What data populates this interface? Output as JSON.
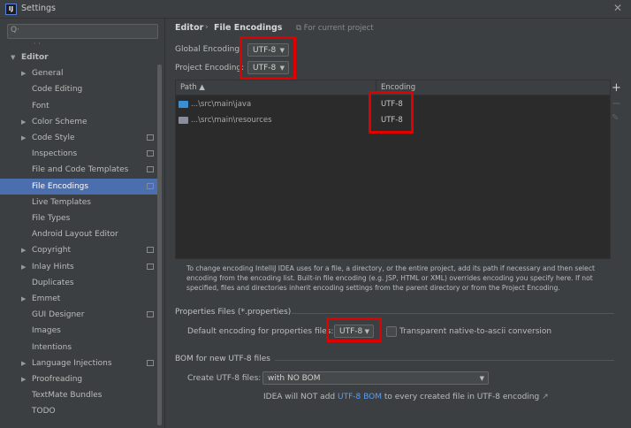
{
  "window": {
    "title": "Settings",
    "app_icon_text": "IJ"
  },
  "sidebar": {
    "search_placeholder": "Q·",
    "items": [
      {
        "label": "Editor",
        "indent": 0,
        "arrow": "expanded",
        "bold": true
      },
      {
        "label": "General",
        "indent": 1,
        "arrow": "collapsed"
      },
      {
        "label": "Code Editing",
        "indent": 1,
        "arrow": "none"
      },
      {
        "label": "Font",
        "indent": 1,
        "arrow": "none"
      },
      {
        "label": "Color Scheme",
        "indent": 1,
        "arrow": "collapsed"
      },
      {
        "label": "Code Style",
        "indent": 1,
        "arrow": "collapsed",
        "project": true
      },
      {
        "label": "Inspections",
        "indent": 1,
        "arrow": "none",
        "project": true
      },
      {
        "label": "File and Code Templates",
        "indent": 1,
        "arrow": "none",
        "project": true
      },
      {
        "label": "File Encodings",
        "indent": 1,
        "arrow": "none",
        "project": true,
        "selected": true
      },
      {
        "label": "Live Templates",
        "indent": 1,
        "arrow": "none"
      },
      {
        "label": "File Types",
        "indent": 1,
        "arrow": "none"
      },
      {
        "label": "Android Layout Editor",
        "indent": 1,
        "arrow": "none"
      },
      {
        "label": "Copyright",
        "indent": 1,
        "arrow": "collapsed",
        "project": true
      },
      {
        "label": "Inlay Hints",
        "indent": 1,
        "arrow": "collapsed",
        "project": true
      },
      {
        "label": "Duplicates",
        "indent": 1,
        "arrow": "none"
      },
      {
        "label": "Emmet",
        "indent": 1,
        "arrow": "collapsed"
      },
      {
        "label": "GUI Designer",
        "indent": 1,
        "arrow": "none",
        "project": true
      },
      {
        "label": "Images",
        "indent": 1,
        "arrow": "none"
      },
      {
        "label": "Intentions",
        "indent": 1,
        "arrow": "none"
      },
      {
        "label": "Language Injections",
        "indent": 1,
        "arrow": "collapsed",
        "project": true
      },
      {
        "label": "Proofreading",
        "indent": 1,
        "arrow": "collapsed"
      },
      {
        "label": "TextMate Bundles",
        "indent": 1,
        "arrow": "none"
      },
      {
        "label": "TODO",
        "indent": 1,
        "arrow": "none"
      }
    ]
  },
  "breadcrumb": {
    "parent": "Editor",
    "separator": "›",
    "current": "File Encodings",
    "note": "For current project"
  },
  "global_encoding": {
    "label": "Global Encoding:",
    "value": "UTF-8"
  },
  "project_encoding": {
    "label": "Project Encoding:",
    "value": "UTF-8"
  },
  "table": {
    "headers": {
      "path": "Path ▲",
      "encoding": "Encoding"
    },
    "rows": [
      {
        "path": "...\\src\\main\\java",
        "encoding": "UTF-8",
        "folder_color": "#3a8fd1"
      },
      {
        "path": "...\\src\\main\\resources",
        "encoding": "UTF-8",
        "folder_color": "#8b8f9b"
      }
    ],
    "toolbar": {
      "add": "+",
      "remove": "−",
      "edit": "✎"
    }
  },
  "info_text": "To change encoding IntelliJ IDEA uses for a file, a directory, or the entire project, add its path if necessary and then select encoding from the encoding list. Built-in file encoding (e.g. JSP, HTML or XML) overrides encoding you specify here. If not specified, files and directories inherit encoding settings from the parent directory or from the Project Encoding.",
  "properties": {
    "section_title": "Properties Files (*.properties)",
    "default_label": "Default encoding for properties files:",
    "default_value": "UTF-8",
    "transparent_label": "Transparent native-to-ascii conversion"
  },
  "bom": {
    "section_title": "BOM for new UTF-8 files",
    "create_label": "Create UTF-8 files:",
    "create_value": "with NO BOM",
    "note_prefix": "IDEA will NOT add ",
    "note_link": "UTF-8 BOM",
    "note_suffix": " to every created file in UTF-8 encoding",
    "note_ext": "↗"
  },
  "colors": {
    "highlight": "#e00000",
    "selection": "#4b6eaf",
    "link": "#589df6"
  }
}
